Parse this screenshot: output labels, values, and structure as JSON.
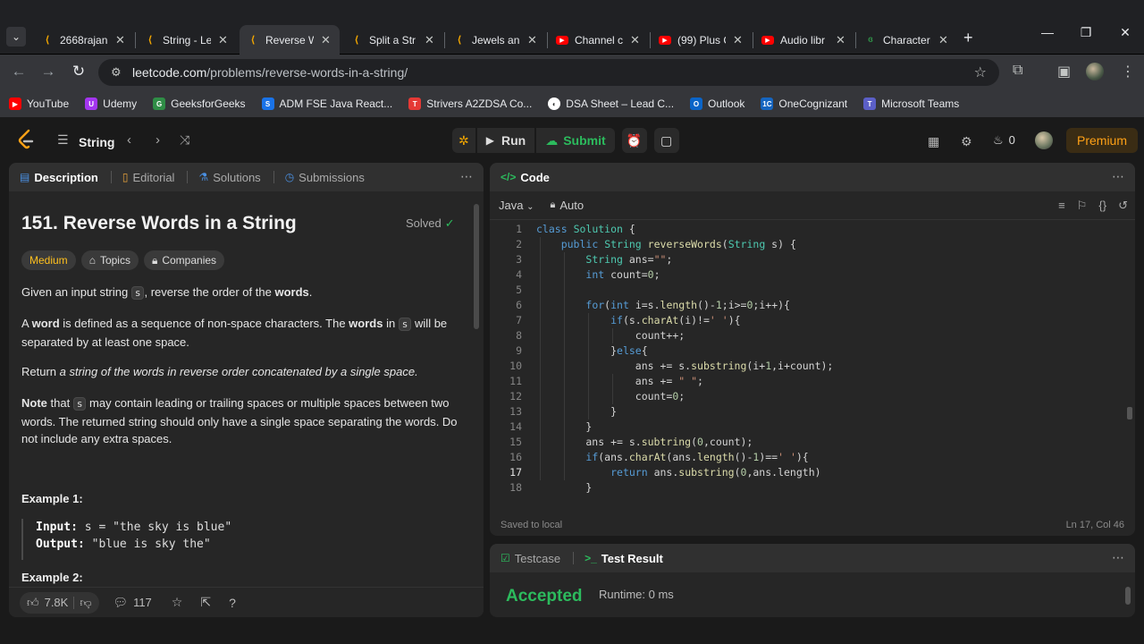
{
  "browser": {
    "tabs": [
      {
        "label": "2668rajan",
        "favicon": "leetcode-icon",
        "active": false
      },
      {
        "label": "String - Le",
        "favicon": "leetcode-icon",
        "active": false
      },
      {
        "label": "Reverse W",
        "favicon": "leetcode-icon",
        "active": true
      },
      {
        "label": "Split a Str",
        "favicon": "leetcode-icon",
        "active": false
      },
      {
        "label": "Jewels an",
        "favicon": "leetcode-icon",
        "active": false
      },
      {
        "label": "Channel c",
        "favicon": "youtube-icon",
        "active": false
      },
      {
        "label": "(99) Plus C",
        "favicon": "youtube-icon",
        "active": false
      },
      {
        "label": "Audio libr",
        "favicon": "youtube-icon",
        "active": false
      },
      {
        "label": "Character",
        "favicon": "geeksforgeeks-icon",
        "active": false
      }
    ],
    "url_host": "leetcode.com",
    "url_path": "/problems/reverse-words-in-a-string/",
    "bookmarks": [
      {
        "label": "YouTube",
        "color": "#ff0000",
        "glyph": "▶"
      },
      {
        "label": "Udemy",
        "color": "#a435f0",
        "glyph": "U"
      },
      {
        "label": "GeeksforGeeks",
        "color": "#2f8d46",
        "glyph": "G"
      },
      {
        "label": "ADM FSE Java React...",
        "color": "#1a73e8",
        "glyph": "S"
      },
      {
        "label": "Strivers A2ZDSA Co...",
        "color": "#e53935",
        "glyph": "T"
      },
      {
        "label": "DSA Sheet – Lead C...",
        "color": "#ffffff",
        "glyph": "◐"
      },
      {
        "label": "Outlook",
        "color": "#0a64c8",
        "glyph": "O"
      },
      {
        "label": "OneCognizant",
        "color": "#1565c0",
        "glyph": "1C"
      },
      {
        "label": "Microsoft Teams",
        "color": "#5b5fc7",
        "glyph": "T"
      }
    ]
  },
  "lcnav": {
    "problem_list": "String",
    "run": "Run",
    "submit": "Submit",
    "fire_count": "0",
    "premium": "Premium"
  },
  "description": {
    "tabs": [
      "Description",
      "Editorial",
      "Solutions",
      "Submissions"
    ],
    "title": "151. Reverse Words in a String",
    "status": "Solved",
    "difficulty": "Medium",
    "chips": [
      "Topics",
      "Companies"
    ],
    "p1_pre": "Given an input string ",
    "p1_code": "s",
    "p1_mid": ", reverse the order of the ",
    "p1_bold": "words",
    "p1_end": ".",
    "p2_a": "A ",
    "p2_bold1": "word",
    "p2_b": " is defined as a sequence of non-space characters. The ",
    "p2_bold2": "words",
    "p2_c": " in ",
    "p2_code": "s",
    "p2_d": " will be separated by at least one space.",
    "p3_pre": "Return ",
    "p3_ital": "a string of the words in reverse order concatenated by a single space.",
    "p4_bold": "Note",
    "p4_a": " that ",
    "p4_code": "s",
    "p4_b": " may contain leading or trailing spaces or multiple spaces between two words. The returned string should only have a single space separating the words. Do not include any extra spaces.",
    "example1_title": "Example 1:",
    "example1_input_label": "Input:",
    "example1_input": " s = \"the sky is blue\"",
    "example1_output_label": "Output:",
    "example1_output": " \"blue is sky the\"",
    "example2_title": "Example 2:",
    "likes": "7.8K",
    "comments": "117"
  },
  "code_panel": {
    "title": "Code",
    "language": "Java",
    "mode": "Auto",
    "saved": "Saved to local",
    "cursor": "Ln 17, Col 46",
    "current_line": 17
  },
  "result_panel": {
    "tab_testcase": "Testcase",
    "tab_result": "Test Result",
    "status": "Accepted",
    "runtime": "Runtime: 0 ms"
  }
}
